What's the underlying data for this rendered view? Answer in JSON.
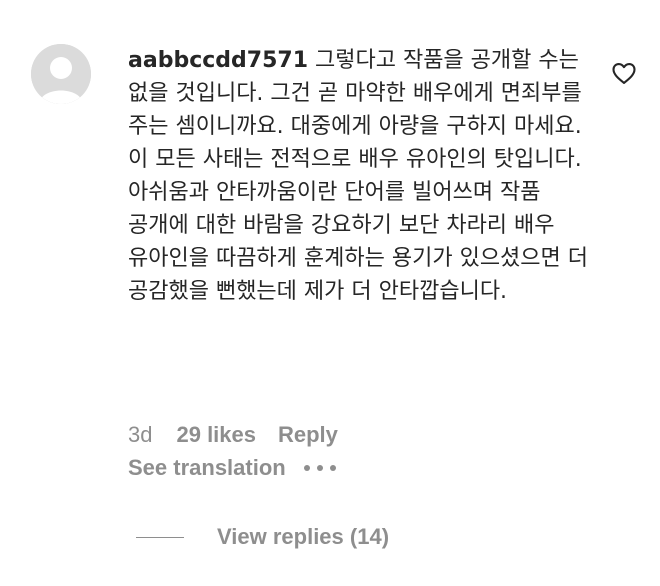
{
  "comment": {
    "username": "aabbccdd7571",
    "text": "그렇다고 작품을 공개할 수는 없을 것입니다. 그건 곧 마약한 배우에게 면죄부를 주는 셈이니까요. 대중에게 아량을 구하지 마세요. 이 모든 사태는 전적으로 배우 유아인의 탓입니다. 아쉬움과 안타까움이란 단어를 빌어쓰며 작품 공개에 대한 바람을 강요하기 보단 차라리 배우 유아인을 따끔하게 훈계하는 용기가 있으셨으면 더 공감했을 뻔했는데 제가 더 안타깝습니다.",
    "like_icon": "heart-outline-icon",
    "avatar_icon": "default-avatar-icon"
  },
  "meta": {
    "time": "3d",
    "likes": "29 likes",
    "reply_label": "Reply"
  },
  "translation": {
    "label": "See translation",
    "more_icon": "more-options-icon"
  },
  "replies": {
    "label": "View replies (14)"
  },
  "colors": {
    "text": "#262626",
    "secondary": "#8e8e8e",
    "avatar_bg": "#dbdbdb",
    "background": "#ffffff"
  }
}
